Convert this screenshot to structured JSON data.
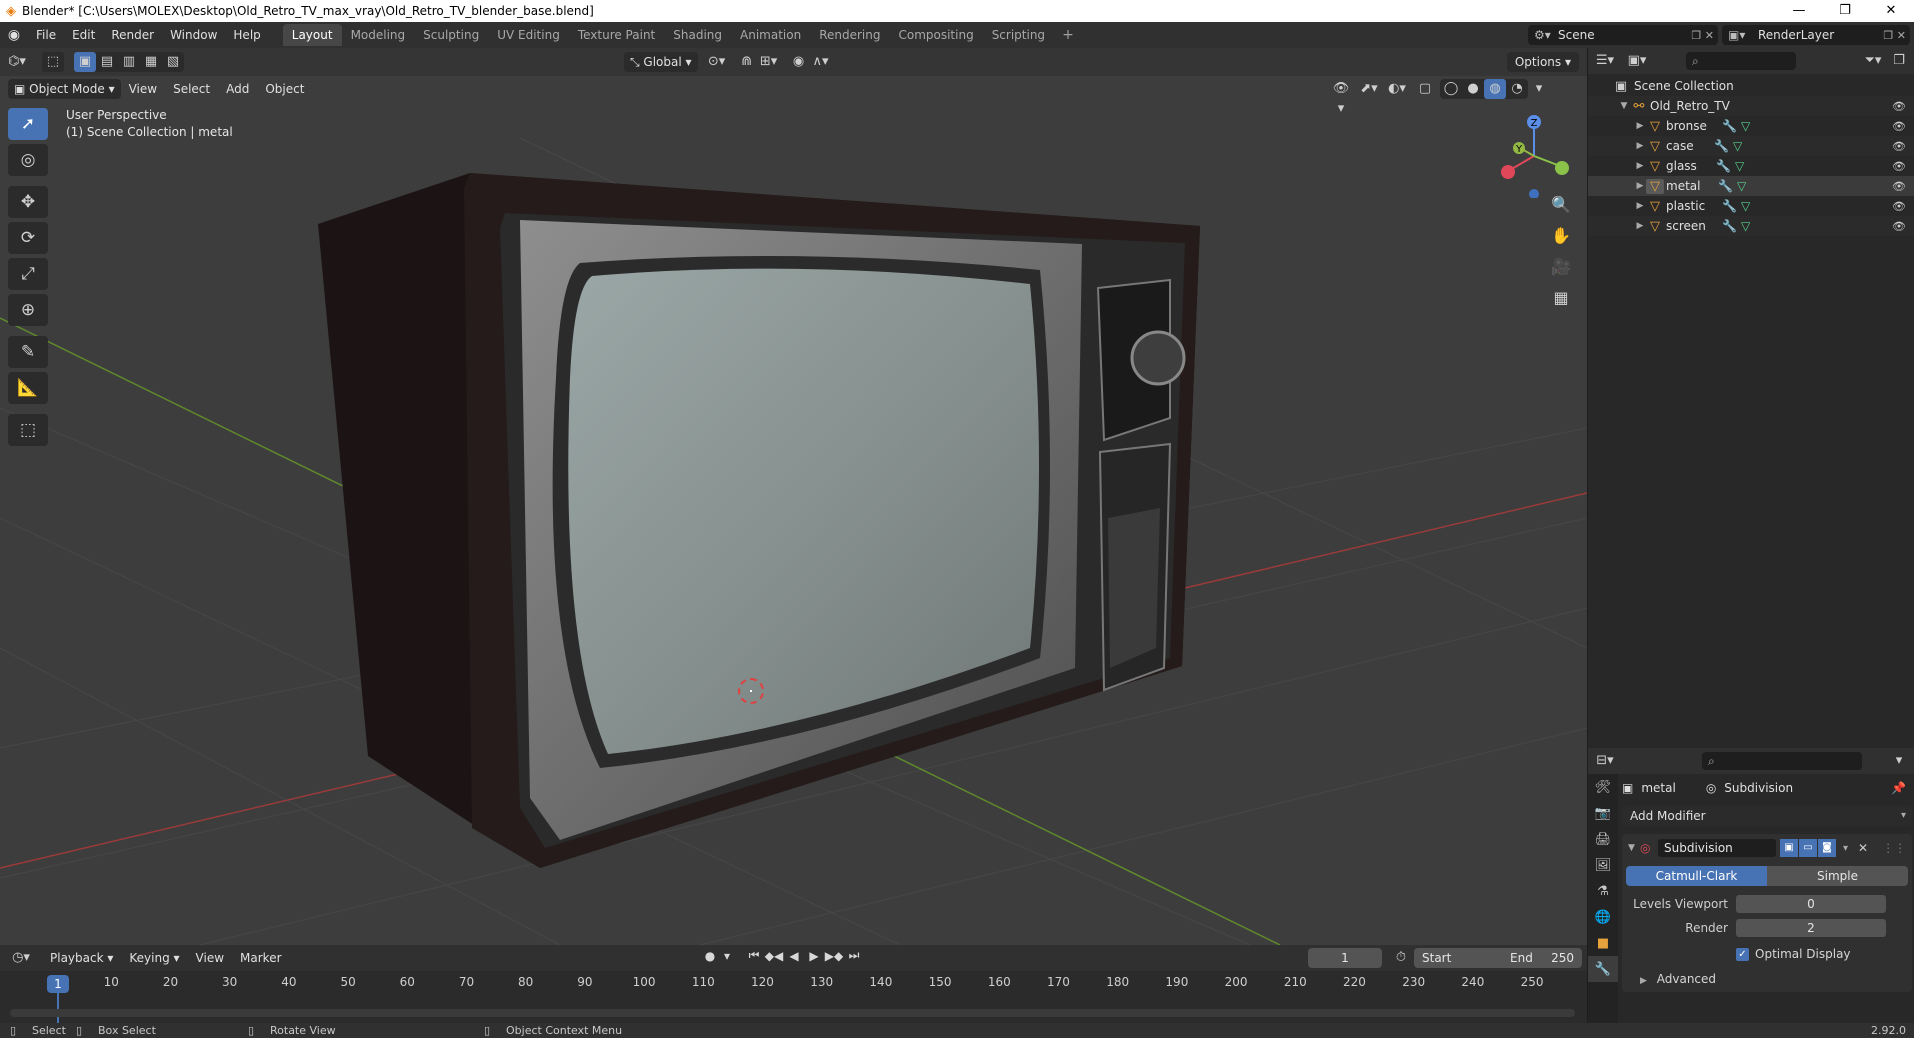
{
  "window": {
    "title": "Blender* [C:\\Users\\MOLEX\\Desktop\\Old_Retro_TV_max_vray\\Old_Retro_TV_blender_base.blend]",
    "minimize": "—",
    "maximize": "❐",
    "close": "✕"
  },
  "menu": [
    "File",
    "Edit",
    "Render",
    "Window",
    "Help"
  ],
  "workspaces": [
    "Layout",
    "Modeling",
    "Sculpting",
    "UV Editing",
    "Texture Paint",
    "Shading",
    "Animation",
    "Rendering",
    "Compositing",
    "Scripting"
  ],
  "active_workspace": "Layout",
  "scene": {
    "name": "Scene",
    "view_layer": "RenderLayer"
  },
  "viewport": {
    "transform_orientation": "Global",
    "options_label": "Options",
    "mode": "Object Mode",
    "menus": [
      "View",
      "Select",
      "Add",
      "Object"
    ],
    "overlay_line1": "User Perspective",
    "overlay_line2": "(1) Scene Collection | metal",
    "gizmo": {
      "x": "X",
      "y": "Y",
      "z": "Z"
    }
  },
  "outliner": {
    "root": "Scene Collection",
    "collection": "Old_Retro_TV",
    "objects": [
      "bronse",
      "case",
      "glass",
      "metal",
      "plastic",
      "screen"
    ],
    "selected": "metal"
  },
  "properties": {
    "object": "metal",
    "modifier": "Subdivision",
    "add_modifier_label": "Add Modifier",
    "modifier_name": "Subdivision",
    "modes": [
      "Catmull-Clark",
      "Simple"
    ],
    "active_mode": "Catmull-Clark",
    "levels_viewport_label": "Levels Viewport",
    "levels_viewport": "0",
    "render_label": "Render",
    "render_levels": "2",
    "optimal_display_label": "Optimal Display",
    "optimal_display": true,
    "advanced_label": "Advanced"
  },
  "timeline": {
    "menus": [
      "Playback",
      "Keying",
      "View",
      "Marker"
    ],
    "current_frame": "1",
    "start_label": "Start",
    "start": "1",
    "end_label": "End",
    "end": "250",
    "ticks": [
      "10",
      "20",
      "30",
      "40",
      "50",
      "60",
      "70",
      "80",
      "90",
      "100",
      "110",
      "120",
      "130",
      "140",
      "150",
      "160",
      "170",
      "180",
      "190",
      "200",
      "210",
      "220",
      "230",
      "240",
      "250"
    ]
  },
  "statusbar": {
    "select": "Select",
    "box_select": "Box Select",
    "rotate_view": "Rotate View",
    "context_menu": "Object Context Menu",
    "version": "2.92.0"
  },
  "colors": {
    "accent": "#4772b3",
    "object_orange": "#e8a23c",
    "background": "#3d3d3d"
  }
}
